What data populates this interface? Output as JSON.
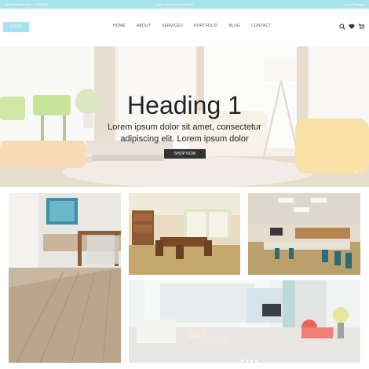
{
  "topbar": {
    "left": "info@example.com  +1 234 567",
    "middle": "Lorem ipsum dolor sit amet",
    "right": "Login  Register"
  },
  "header": {
    "logo": "LOGO",
    "nav": [
      "HOME",
      "ABOUT",
      "SERVICES",
      "PORTFOLIO",
      "BLOG",
      "CONTACT"
    ],
    "icons": [
      "search-icon",
      "heart-icon",
      "cart-icon"
    ]
  },
  "hero": {
    "title": "Heading 1",
    "subtitle": "Lorem ipsum dolor sit amet, consectetur adipiscing elit. Lorem ipsum dolor",
    "button": "SHOP NOW",
    "arrow": "›"
  },
  "gallery": {
    "images": [
      "kitchen-dining-photo",
      "dining-room-photo",
      "conference-room-photo",
      "living-room-photo"
    ]
  },
  "colors": {
    "accent": "#a8e3f0",
    "button": "#333333"
  }
}
